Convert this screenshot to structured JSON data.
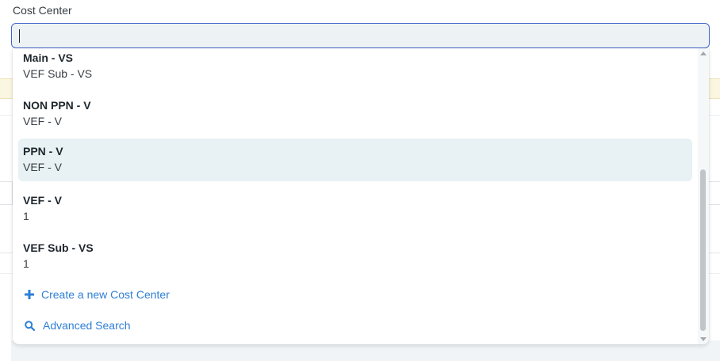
{
  "field": {
    "label": "Cost Center",
    "value": ""
  },
  "dropdown": {
    "items": [
      {
        "title": "Main - VS",
        "description": "VEF Sub - VS",
        "highlighted": false
      },
      {
        "title": "NON PPN - V",
        "description": "VEF - V",
        "highlighted": false
      },
      {
        "title": "PPN - V",
        "description": "VEF - V",
        "highlighted": true
      },
      {
        "title": "VEF - V",
        "description": "1",
        "highlighted": false
      },
      {
        "title": "VEF Sub - VS",
        "description": "1",
        "highlighted": false
      }
    ],
    "actions": {
      "create_label": "Create a new Cost Center",
      "create_icon": "plus-icon",
      "search_label": "Advanced Search",
      "search_icon": "search-icon"
    }
  },
  "colors": {
    "accent": "#2e7fd6",
    "input_border": "#4565cc",
    "highlight": "#e8f1f3"
  }
}
